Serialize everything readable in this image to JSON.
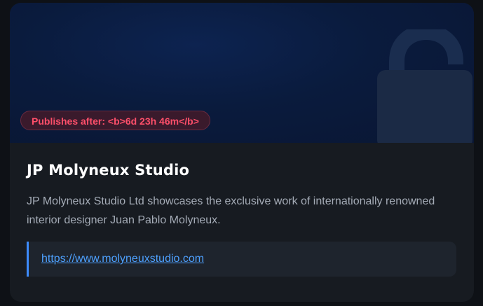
{
  "card": {
    "badge": {
      "label": "Publishes after: <b>6d 23h 46m</b>"
    },
    "title": "JP Molyneux Studio",
    "description": "JP Molyneux Studio Ltd showcases the exclusive work of internationally renowned interior designer Juan Pablo Molyneux.",
    "link": {
      "text": "https://www.molyneuxstudio.com"
    },
    "icon": "lock-open-icon"
  },
  "colors": {
    "hero_bg": "#0a1b3d",
    "card_bg": "#171b21",
    "badge_text": "#ff4f6a",
    "badge_bg": "#3a1a2c",
    "link": "#4ea1ff",
    "link_accent": "#3d8bfd"
  }
}
